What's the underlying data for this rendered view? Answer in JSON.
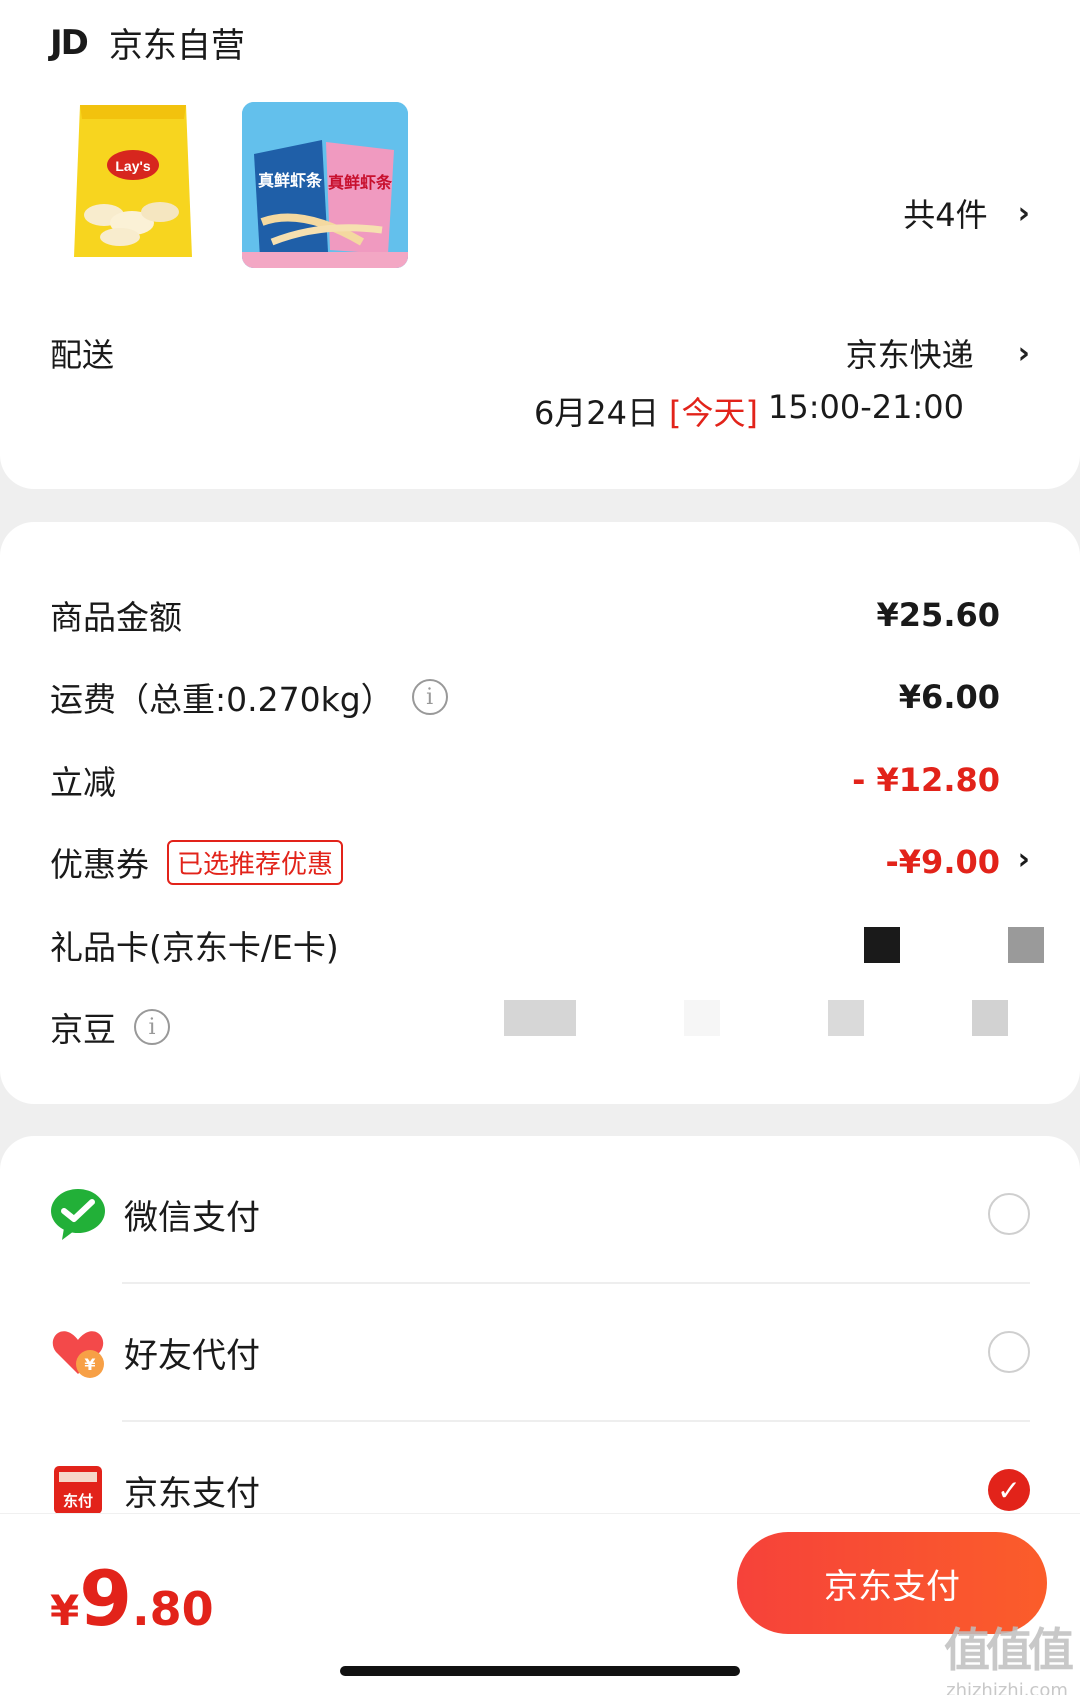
{
  "shop": {
    "logo_text": "JD",
    "name": "京东自营",
    "item_count": "共4件"
  },
  "delivery": {
    "label": "配送",
    "method": "京东快递",
    "date": "6月24日",
    "today": "[今天]",
    "time": "15:00-21:00"
  },
  "price_details": {
    "goods_amount_label": "商品金额",
    "goods_amount": "¥25.60",
    "shipping_label": "运费（总重:0.270kg）",
    "shipping_amount": "¥6.00",
    "instant_discount_label": "立减",
    "instant_discount": "- ¥12.80",
    "coupon_label": "优惠券",
    "coupon_tag": "已选推荐优惠",
    "coupon_amount": "-¥9.00",
    "gift_card_label": "礼品卡(京东卡/E卡)",
    "jd_beans_label": "京豆"
  },
  "payment_methods": [
    {
      "label": "微信支付",
      "icon": "wechat-pay-icon",
      "selected": false
    },
    {
      "label": "好友代付",
      "icon": "friend-pay-icon",
      "selected": false
    },
    {
      "label": "京东支付",
      "icon": "jd-pay-icon",
      "selected": true
    }
  ],
  "checkout": {
    "total_yen": "¥",
    "total_int": "9",
    "total_dec": ".80",
    "pay_button_label": "京东支付"
  },
  "watermark": {
    "mark": "值值值",
    "url": "zhizhizhi.com"
  },
  "colors": {
    "accent_red": "#e2231a",
    "background": "#efefef",
    "card": "#ffffff"
  }
}
